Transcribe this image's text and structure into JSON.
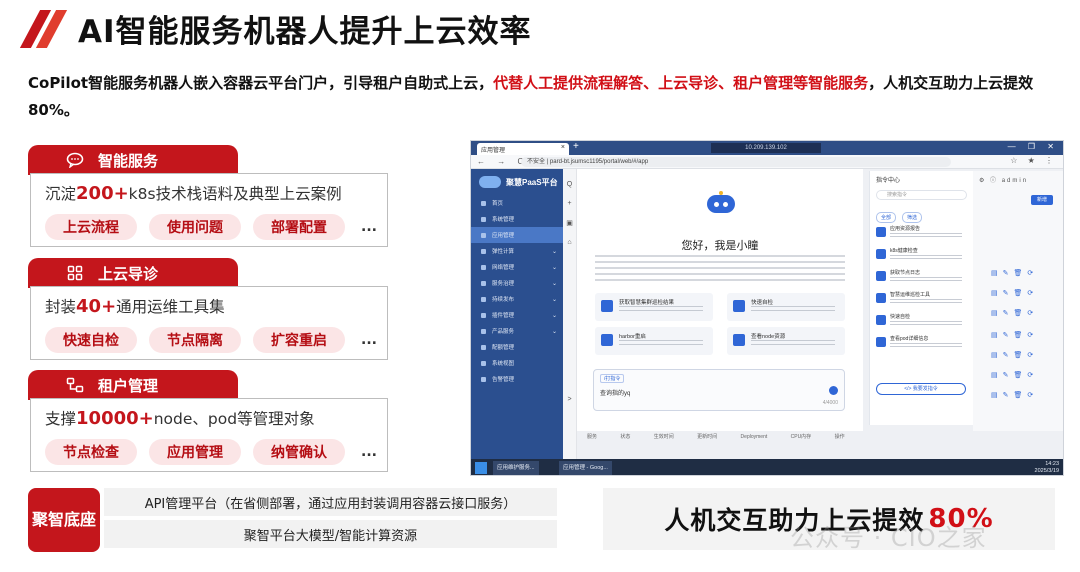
{
  "header": {
    "title": "AI智能服务机器人提升上云效率",
    "intro_part1": "CoPilot智能服务机器人嵌入容器云平台门户，引导租户自助式上云，",
    "intro_red": "代替人工提供流程解答、上云导诊、租户管理等智能服务",
    "intro_part2": "，人机交互助力上云提效80%。"
  },
  "cards": [
    {
      "title": "智能服务",
      "icon": "chat-bubble-icon",
      "line_prefix": "沉淀",
      "line_number": "200+",
      "line_suffix": "k8s技术栈语料及典型上云案例",
      "chips": [
        "上云流程",
        "使用问题",
        "部署配置"
      ],
      "more": "..."
    },
    {
      "title": "上云导诊",
      "icon": "grid-icon",
      "line_prefix": "封装",
      "line_number": "40+",
      "line_suffix": "通用运维工具集",
      "chips": [
        "快速自检",
        "节点隔离",
        "扩容重启"
      ],
      "more": "..."
    },
    {
      "title": "租户管理",
      "icon": "network-icon",
      "line_prefix": "支撑",
      "line_number": "10000+",
      "line_suffix": "node、pod等管理对象",
      "chips": [
        "节点检查",
        "应用管理",
        "纳管确认"
      ],
      "more": "..."
    }
  ],
  "base": {
    "badge": "聚智底座",
    "row1": "API管理平台（在省侧部署，通过应用封装调用容器云接口服务）",
    "row2": "聚智平台大模型/智能计算资源"
  },
  "result": {
    "text": "人机交互助力上云提效",
    "percent": "80%"
  },
  "watermark": "公众号 · CIO之家",
  "screenshot": {
    "tab_title": "应用管理",
    "tab_close": "×",
    "new_tab": "+",
    "remote_addr": "10.209.139.102",
    "window_buttons": "— ❐ ✕",
    "nav": "← → C",
    "url": "不安全 | pard-bt.jsumsc1195/portal/web/#/app",
    "addr_icons": "☆ ★ ⋮",
    "app_name": "聚慧PaaS平台",
    "menu": [
      "首页",
      "系统管理",
      "应用管理",
      "弹性计算",
      "网络管理",
      "服务治理",
      "持续发布",
      "插件管理",
      "产品服务",
      "配额管理",
      "系统视图",
      "告警管理"
    ],
    "iconbar": [
      "Q",
      "+",
      "▣",
      "⌂",
      ">"
    ],
    "greeting": "您好，我是小瞳",
    "quick_cards": [
      "获取智慧集群巡检结果",
      "快速自检",
      "harbor重启",
      "查看node资源"
    ],
    "input_label": "/打指令",
    "input_value": "查询指的yq",
    "input_count": "4/4000",
    "panel_title": "指令中心",
    "panel_search": "搜索指令",
    "panel_tabs": [
      "全部",
      "筛选"
    ],
    "panel_items": [
      "应用资源报告",
      "k8s健康检查",
      "获取节点日志",
      "智慧运维巡检工具",
      "快速自检",
      "查看pod详细信息"
    ],
    "panel_button": "</> 我要发指令",
    "top_right": "⚙ ⓘ admin",
    "top_right_button": "新增",
    "bottom_cols": "服务 状态 生效时间 更新时间 Deployment CPU内存 操作",
    "task_items": [
      "应用维护服务...",
      "应用管理 - Goog..."
    ],
    "clock_time": "14:23",
    "clock_date": "2025/3/19"
  }
}
